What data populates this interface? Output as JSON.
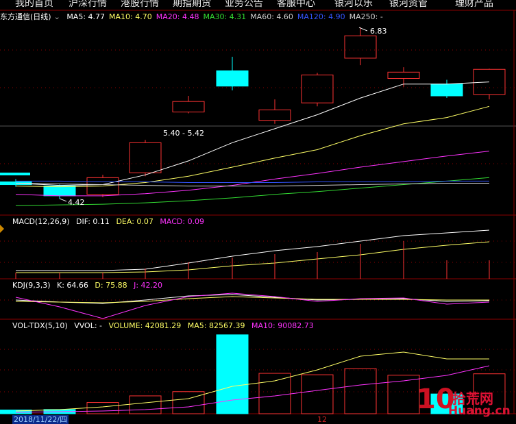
{
  "menu": [
    "我的首页",
    "沪深行情",
    "港股行情",
    "期指期货",
    "业务公告",
    "客服中心",
    "银河以乐",
    "银河资管",
    "理财产品"
  ],
  "main": {
    "title": "东方通信(日线)",
    "ma": [
      {
        "label": "MA5: 4.77",
        "color": "#ffffff"
      },
      {
        "label": "MA10: 4.70",
        "color": "#ffff66"
      },
      {
        "label": "MA20: 4.48",
        "color": "#ff33ff"
      },
      {
        "label": "MA30: 4.31",
        "color": "#33dd33"
      },
      {
        "label": "MA60: 4.60",
        "color": "#cfcfcf"
      },
      {
        "label": "MA120: 4.90",
        "color": "#3355ff"
      },
      {
        "label": "MA250: -",
        "color": "#cfcfcf"
      }
    ],
    "high_label": "6.83",
    "low_label": "4.42",
    "range_label": "5.40 - 5.42"
  },
  "macd": {
    "title": "MACD(12,26,9)",
    "dif": "DIF: 0.11",
    "dea": "DEA: 0.07",
    "macd": "MACD: 0.09"
  },
  "kdj": {
    "title": "KDJ(9,3,3)",
    "k": "K: 64.66",
    "d": "D: 75.88",
    "j": "J: 42.20"
  },
  "vol": {
    "title": "VOL-TDX(5,10)",
    "vvol": "VVOL: -",
    "volume": "VOLUME: 42081.29",
    "ma5": "MA5: 82567.39",
    "ma10": "MA10: 90082.73"
  },
  "footer": {
    "date": "2018/11/22/四",
    "mid": "12"
  },
  "watermark": {
    "text": "拾荒网",
    "sub": "Huang.cn",
    "digits": "10"
  },
  "colors": {
    "up": "#ff3333",
    "down": "#00ffff",
    "ma5": "#ffffff",
    "ma10": "#ffff66",
    "ma20": "#ff33ff",
    "ma30": "#33dd33",
    "ma60": "#cfcfcf",
    "ma120": "#3355ff",
    "grid": "#8b0000"
  },
  "chart_data": {
    "type": "candlestick",
    "candles": [
      {
        "open": 4.62,
        "close": 4.58,
        "high": 4.66,
        "low": 4.55,
        "volume": 8000
      },
      {
        "open": 4.56,
        "close": 4.42,
        "high": 4.58,
        "low": 4.38,
        "volume": 9000
      },
      {
        "open": 4.44,
        "close": 4.68,
        "high": 4.72,
        "low": 4.4,
        "volume": 24000
      },
      {
        "open": 4.75,
        "close": 5.18,
        "high": 5.22,
        "low": 4.7,
        "volume": 38000
      },
      {
        "open": 5.62,
        "close": 5.77,
        "high": 5.85,
        "low": 5.6,
        "volume": 47000
      },
      {
        "open": 6.21,
        "close": 5.99,
        "high": 6.41,
        "low": 5.93,
        "volume": 168000
      },
      {
        "open": 5.5,
        "close": 5.65,
        "high": 5.8,
        "low": 5.45,
        "volume": 86000
      },
      {
        "open": 5.75,
        "close": 6.15,
        "high": 6.18,
        "low": 5.7,
        "volume": 83000
      },
      {
        "open": 6.39,
        "close": 6.71,
        "high": 6.83,
        "low": 6.29,
        "volume": 96000
      },
      {
        "open": 6.1,
        "close": 6.19,
        "high": 6.26,
        "low": 5.98,
        "volume": 82000
      },
      {
        "open": 6.02,
        "close": 5.85,
        "high": 6.08,
        "low": 5.82,
        "volume": 42081.29
      },
      {
        "open": 5.87,
        "close": 6.23,
        "high": 6.24,
        "low": 5.8,
        "volume": 85000
      }
    ]
  }
}
